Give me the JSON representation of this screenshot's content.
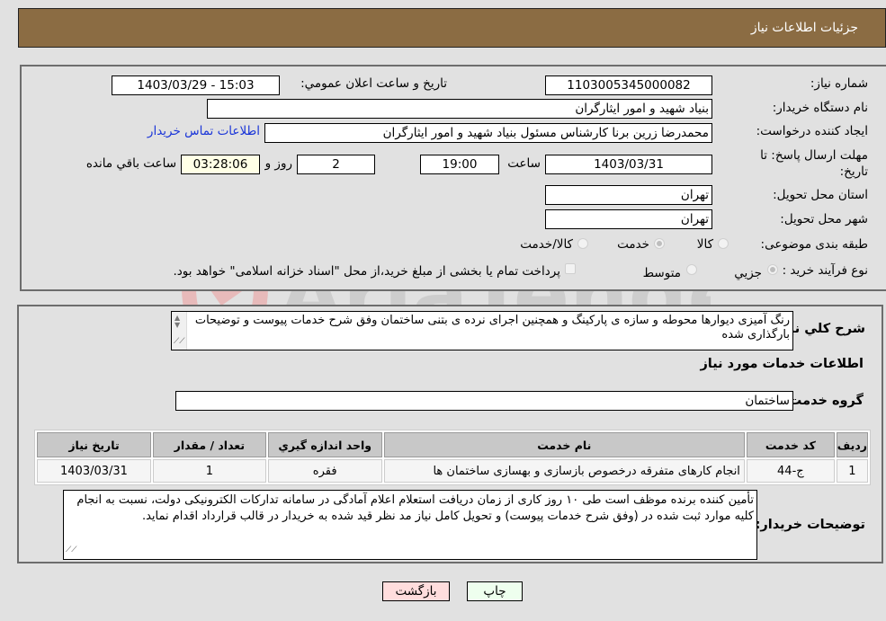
{
  "header": {
    "title": "جزئیات اطلاعات نیاز"
  },
  "fields": {
    "need_number": {
      "label": "شماره نیاز:",
      "value": "1103005345000082"
    },
    "announce_datetime": {
      "label": "تاريخ و ساعت اعلان عمومي:",
      "value": "1403/03/29 - 15:03"
    },
    "buyer_org": {
      "label": "نام دستگاه خريدار:",
      "value": "بنیاد شهید و امور ایثارگران"
    },
    "requester": {
      "label": "ايجاد کننده درخواست:",
      "value": "محمدرضا زرین برنا کارشناس مسئول  بنیاد شهید و امور ایثارگران"
    },
    "buyer_contact_link": "اطلاعات تماس خريدار",
    "deadline": {
      "label": "مهلت ارسال پاسخ: تا تاريخ:",
      "date": "1403/03/31",
      "time_label": "ساعت",
      "time": "19:00",
      "days": "2",
      "days_label": "روز و",
      "remaining": "03:28:06",
      "remaining_label": "ساعت باقي مانده"
    },
    "province": {
      "label": "استان محل تحويل:",
      "value": "تهران"
    },
    "city": {
      "label": "شهر محل تحويل:",
      "value": "تهران"
    },
    "category": {
      "label": "طبقه بندی موضوعی:",
      "options": [
        "کالا",
        "خدمت",
        "کالا/خدمت"
      ],
      "selected": "خدمت"
    },
    "purchase_type": {
      "label": "نوع فرآيند خريد :",
      "options": [
        "جزيي",
        "متوسط"
      ],
      "selected": "جزيي",
      "treasury_note": "پرداخت تمام یا بخشی از مبلغ خرید،از محل \"اسناد خزانه اسلامی\" خواهد بود."
    }
  },
  "description": {
    "label": "شرح کلي نياز:",
    "text": "رنگ آمیزی دیوارها محوطه و سازه ی پارکینگ و همچنین اجرای نرده ی بتنی ساختمان وفق شرح خدمات پیوست و توضیحات بارگذاری شده"
  },
  "services_section": {
    "title": "اطلاعات خدمات مورد نياز",
    "group_label": "گروه خدمت:",
    "group_value": "ساختمان",
    "table": {
      "headers": [
        "رديف",
        "کد خدمت",
        "نام خدمت",
        "واحد اندازه گيري",
        "تعداد / مقدار",
        "تاريخ نياز"
      ],
      "rows": [
        [
          "1",
          "ج-44",
          "انجام کارهای متفرقه درخصوص بازسازی و بهسازی ساختمان ها",
          "فقره",
          "1",
          "1403/03/31"
        ]
      ]
    }
  },
  "buyer_notes": {
    "label": "توضيحات خريدار:",
    "text": "تأمین کننده برنده موظف است طی ۱۰ روز کاری از زمان دریافت استعلام اعلام آمادگی در سامانه تدارکات الکترونیکی دولت، نسبت به انجام کلیه موارد ثبت شده در (وفق شرح خدمات پیوست) و تحویل کامل نیاز مد نظر قید شده به خریدار در قالب قرارداد اقدام نماید."
  },
  "buttons": {
    "print": "چاپ",
    "back": "بازگشت"
  },
  "watermark": "AriaTender.neT",
  "colors": {
    "header": "#8b6c43",
    "back_button": "#ffdddd",
    "print_button": "#eeffee",
    "link": "#1a35d8"
  }
}
